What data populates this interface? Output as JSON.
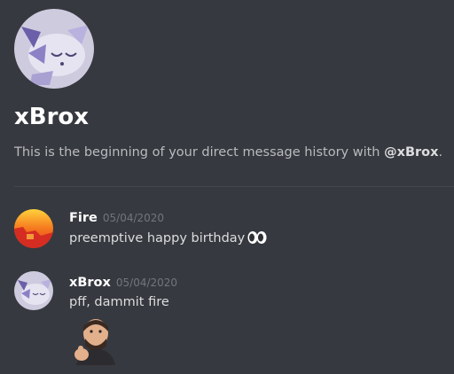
{
  "channel": {
    "name": "xBrox",
    "intro_prefix": "This is the beginning of your direct message history with ",
    "intro_mention": "@xBrox",
    "intro_suffix": "."
  },
  "messages": [
    {
      "author": "Fire",
      "timestamp": "05/04/2020",
      "text": "preemptive happy birthday",
      "emoji": "eyes-emoji"
    },
    {
      "author": "xBrox",
      "timestamp": "05/04/2020",
      "text": "pff, dammit fire",
      "attachment": "thinking-man-emote"
    }
  ],
  "colors": {
    "background": "#36393f",
    "username": "#ffffff",
    "timestamp": "#72767d",
    "text": "#dcddde",
    "intro": "#b9bbbe"
  }
}
